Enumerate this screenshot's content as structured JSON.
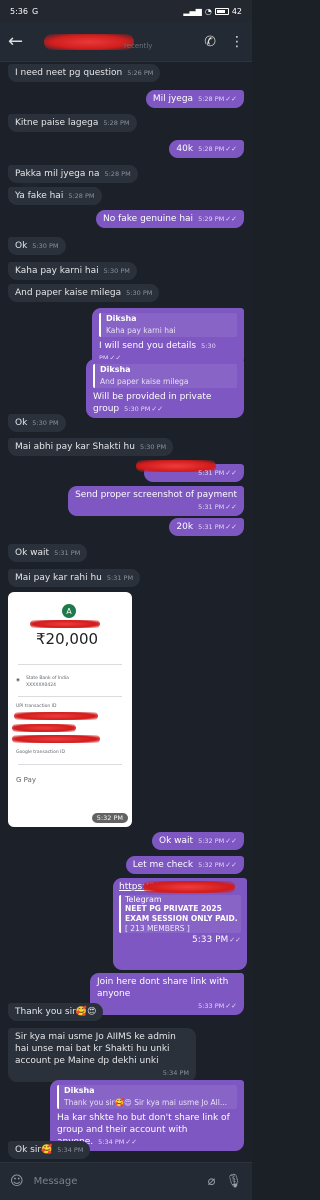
{
  "status_bar": {
    "time": "5:36",
    "carrier_icon": "G",
    "battery": "42"
  },
  "header": {
    "last_seen": "recently"
  },
  "messages": [
    {
      "text": "I need neet pg question",
      "time": "5:26 PM"
    },
    {
      "text": "Mil jyega",
      "time": "5:28 PM"
    },
    {
      "text": "Kitne paise lagega",
      "time": "5:28 PM"
    },
    {
      "text": "40k",
      "time": "5:28 PM"
    },
    {
      "text": "Pakka mil jyega na",
      "time": "5:28 PM"
    },
    {
      "text": "Ya fake hai",
      "time": "5:28 PM"
    },
    {
      "text": "No fake genuine hai",
      "time": "5:29 PM"
    },
    {
      "text": "Ok",
      "time": "5:30 PM"
    },
    {
      "text": "Kaha pay karni hai",
      "time": "5:30 PM"
    },
    {
      "text": "And paper kaise milega",
      "time": "5:30 PM"
    },
    {
      "quote_name": "Diksha",
      "quote_text": "Kaha pay karni hai",
      "text": "I will send you details",
      "time": "5:30 PM"
    },
    {
      "quote_name": "Diksha",
      "quote_text": "And paper kaise milega",
      "text": "Will be provided in private group",
      "time": "5:30 PM"
    },
    {
      "text": "Ok",
      "time": "5:30 PM"
    },
    {
      "text": "Mai abhi pay kar Shakti hu",
      "time": "5:30 PM"
    },
    {
      "text": "",
      "time": "5:31 PM"
    },
    {
      "text": "Send proper screenshot of payment",
      "time": "5:31 PM"
    },
    {
      "text": "20k",
      "time": "5:31 PM"
    },
    {
      "text": "Ok wait",
      "time": "5:31 PM"
    },
    {
      "text": "Mai pay kar rahi hu",
      "time": "5:31 PM"
    },
    {
      "text": "Ok wait",
      "time": "5:32 PM"
    },
    {
      "text": "Let me check",
      "time": "5:32 PM"
    },
    {
      "text": "Join here dont share link with anyone",
      "time": "5:33 PM"
    },
    {
      "text": "Thank you sir🥰😍",
      "time": ""
    },
    {
      "text": "Sir kya mai usme Jo AIIMS ke admin hai unse mai bat kr Shakti hu unki account pe Maine dp dekhi unki",
      "time": "5:34 PM"
    },
    {
      "quote_name": "Diksha",
      "quote_text": "Thank you sir🥰😍 Sir kya mai usme Jo All...",
      "text": "Ha kar shkte ho but don't share link of group and their account with anyone.",
      "time": "5:34 PM"
    },
    {
      "text": "Ok sir🥰",
      "time": "5:34 PM"
    }
  ],
  "payment_screenshot": {
    "avatar_letter": "A",
    "amount": "₹20,000",
    "bank": "State Bank of India",
    "bank_account": "XXXXXX0424",
    "upi_label": "UPI transaction ID",
    "google_txn_label": "Google transaction ID",
    "app": "G Pay",
    "time": "5:32 PM"
  },
  "link_message": {
    "url": "https://t",
    "site": "Telegram",
    "title": "NEET PG PRIVATE 2025 EXAM SESSION ONLY PAID.",
    "members": "[ 213 MEMBERS ]",
    "time": "5:33 PM"
  },
  "input": {
    "placeholder": "Message"
  },
  "colors": {
    "outgoing": "#7e57c2",
    "incoming": "#2b313b",
    "background": "#1c2028"
  }
}
